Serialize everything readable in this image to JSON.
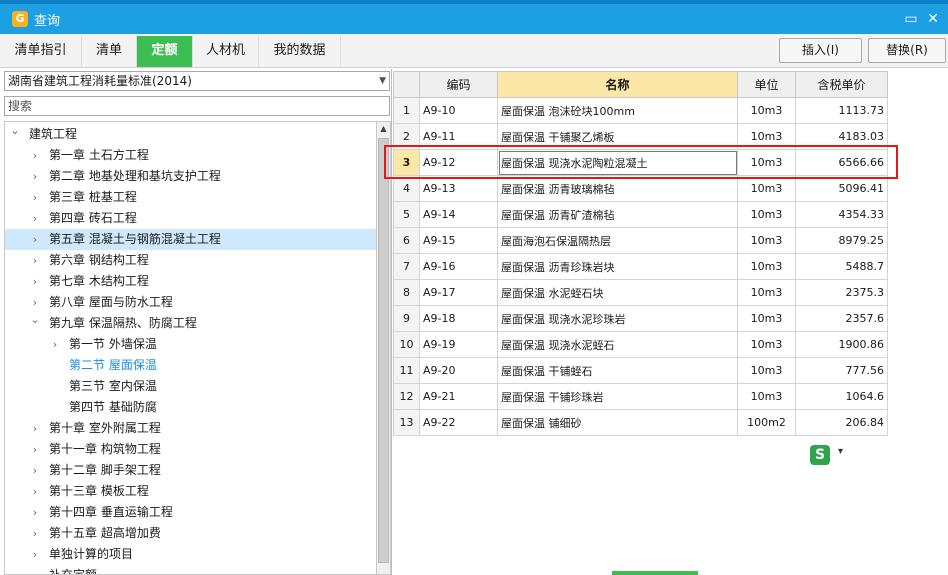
{
  "window": {
    "title": "查询",
    "app_icon": "glodon-icon",
    "maximize_glyph": "▭",
    "close_glyph": "✕"
  },
  "tabs": [
    {
      "label": "清单指引",
      "active": false
    },
    {
      "label": "清单",
      "active": false
    },
    {
      "label": "定额",
      "active": true
    },
    {
      "label": "人材机",
      "active": false
    },
    {
      "label": "我的数据",
      "active": false
    }
  ],
  "actions": {
    "insert_label": "插入(I)",
    "replace_label": "替换(R)"
  },
  "left": {
    "library": "湖南省建筑工程消耗量标准(2014)",
    "search_placeholder": "搜索"
  },
  "tree": [
    {
      "label": "建筑工程",
      "level": 0,
      "expanded": true,
      "has_children": true
    },
    {
      "label": "第一章  土石方工程",
      "level": 1,
      "has_children": true
    },
    {
      "label": "第二章  地基处理和基坑支护工程",
      "level": 1,
      "has_children": true
    },
    {
      "label": "第三章  桩基工程",
      "level": 1,
      "has_children": true
    },
    {
      "label": "第四章  砖石工程",
      "level": 1,
      "has_children": true
    },
    {
      "label": "第五章  混凝土与钢筋混凝土工程",
      "level": 1,
      "has_children": true,
      "selected": true
    },
    {
      "label": "第六章  钢结构工程",
      "level": 1,
      "has_children": true
    },
    {
      "label": "第七章  木结构工程",
      "level": 1,
      "has_children": true
    },
    {
      "label": "第八章  屋面与防水工程",
      "level": 1,
      "has_children": true
    },
    {
      "label": "第九章  保温隔热、防腐工程",
      "level": 1,
      "has_children": true,
      "expanded": true
    },
    {
      "label": "第一节  外墙保温",
      "level": 2,
      "has_children": true
    },
    {
      "label": "第二节  屋面保温",
      "level": 2,
      "has_children": false,
      "active": true
    },
    {
      "label": "第三节  室内保温",
      "level": 2,
      "has_children": false
    },
    {
      "label": "第四节  基础防腐",
      "level": 2,
      "has_children": false
    },
    {
      "label": "第十章  室外附属工程",
      "level": 1,
      "has_children": true
    },
    {
      "label": "第十一章  构筑物工程",
      "level": 1,
      "has_children": true
    },
    {
      "label": "第十二章  脚手架工程",
      "level": 1,
      "has_children": true
    },
    {
      "label": "第十三章  模板工程",
      "level": 1,
      "has_children": true
    },
    {
      "label": "第十四章  垂直运输工程",
      "level": 1,
      "has_children": true
    },
    {
      "label": "第十五章  超高增加费",
      "level": 1,
      "has_children": true
    },
    {
      "label": "单独计算的项目",
      "level": 1,
      "has_children": true
    },
    {
      "label": "补充定额",
      "level": 1,
      "has_children": true
    }
  ],
  "grid": {
    "columns": [
      "",
      "编码",
      "名称",
      "单位",
      "含税单价"
    ],
    "current_row": 3,
    "rows": [
      {
        "no": "1",
        "code": "A9-10",
        "name": "屋面保温  泡沫砼块100mm",
        "unit": "10m3",
        "price": "1113.73"
      },
      {
        "no": "2",
        "code": "A9-11",
        "name": "屋面保温  干铺聚乙烯板",
        "unit": "10m3",
        "price": "4183.03"
      },
      {
        "no": "3",
        "code": "A9-12",
        "name": "屋面保温  现浇水泥陶粒混凝土",
        "unit": "10m3",
        "price": "6566.66"
      },
      {
        "no": "4",
        "code": "A9-13",
        "name": "屋面保温  沥青玻璃棉毡",
        "unit": "10m3",
        "price": "5096.41"
      },
      {
        "no": "5",
        "code": "A9-14",
        "name": "屋面保温  沥青矿渣棉毡",
        "unit": "10m3",
        "price": "4354.33"
      },
      {
        "no": "6",
        "code": "A9-15",
        "name": "屋面海泡石保温隔热层",
        "unit": "10m3",
        "price": "8979.25"
      },
      {
        "no": "7",
        "code": "A9-16",
        "name": "屋面保温  沥青珍珠岩块",
        "unit": "10m3",
        "price": "5488.7"
      },
      {
        "no": "8",
        "code": "A9-17",
        "name": "屋面保温  水泥蛭石块",
        "unit": "10m3",
        "price": "2375.3"
      },
      {
        "no": "9",
        "code": "A9-18",
        "name": "屋面保温  现浇水泥珍珠岩",
        "unit": "10m3",
        "price": "2357.6"
      },
      {
        "no": "10",
        "code": "A9-19",
        "name": "屋面保温  现浇水泥蛭石",
        "unit": "10m3",
        "price": "1900.86"
      },
      {
        "no": "11",
        "code": "A9-20",
        "name": "屋面保温  干铺蛭石",
        "unit": "10m3",
        "price": "777.56"
      },
      {
        "no": "12",
        "code": "A9-21",
        "name": "屋面保温  干铺珍珠岩",
        "unit": "10m3",
        "price": "1064.6"
      },
      {
        "no": "13",
        "code": "A9-22",
        "name": "屋面保温  铺细砂",
        "unit": "100m2",
        "price": "206.84"
      }
    ]
  },
  "ime": {
    "icon": "sogou-ime-icon",
    "glyph": "S",
    "menu_glyph": "▾"
  },
  "colors": {
    "titlebar": "#1d9fe3",
    "active_tab": "#3ebd53",
    "highlight": "#e2191c",
    "selected_row": "#cfe8fb"
  }
}
